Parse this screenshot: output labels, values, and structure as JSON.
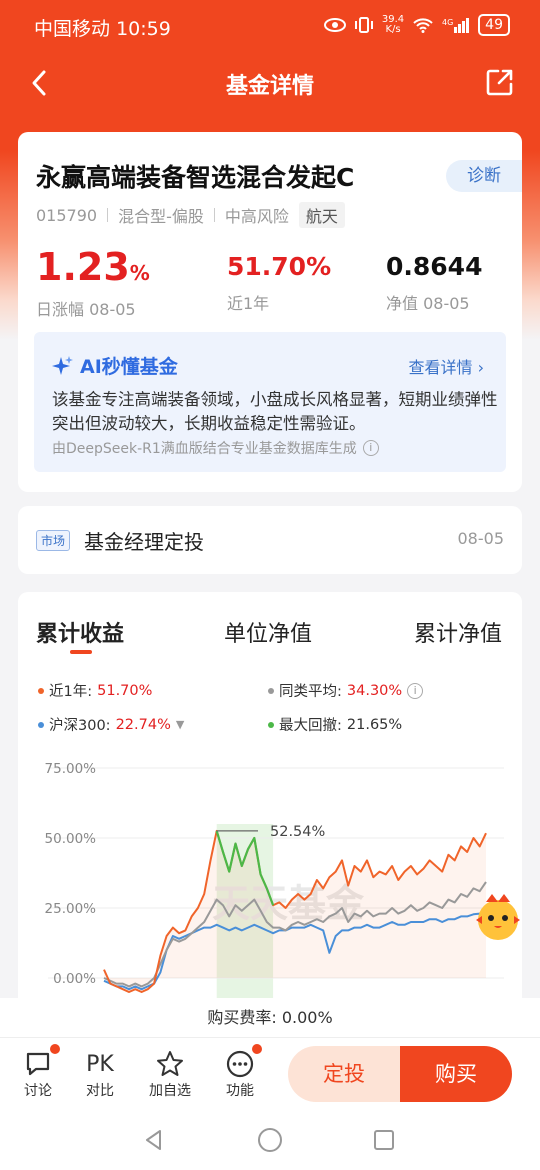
{
  "status_bar": {
    "carrier": "中国移动",
    "time": "10:59",
    "speed_top": "39.4",
    "speed_bottom": "K/s",
    "battery": "49"
  },
  "nav": {
    "title": "基金详情"
  },
  "fund": {
    "name": "永赢高端装备智选混合发起C",
    "diagnose": "诊断",
    "code": "015790",
    "type": "混合型-偏股",
    "risk": "中高风险",
    "sector": "航天",
    "daily_change": "1.23",
    "daily_change_unit": "%",
    "daily_change_label": "日涨幅 08-05",
    "year_return": "51.70%",
    "year_return_label": "近1年",
    "nav_value": "0.8644",
    "nav_label": "净值 08-05"
  },
  "ai": {
    "title": "AI秒懂基金",
    "more": "查看详情",
    "text": "该基金专注高端装备领域，小盘成长风格显著，短期业绩弹性突出但波动较大，长期收益稳定性需验证。",
    "source": "由DeepSeek-R1满血版结合专业基金数据库生成"
  },
  "manager": {
    "tag": "市场",
    "text": "基金经理定投",
    "date": "08-05"
  },
  "chart_tabs": [
    "累计收益",
    "单位净值",
    "累计净值"
  ],
  "legend": {
    "fund_label": "近1年:",
    "fund_value": "51.70%",
    "peer_label": "同类平均:",
    "peer_value": "34.30%",
    "index_label": "沪深300:",
    "index_value": "22.74%",
    "drawdown_label": "最大回撤:",
    "drawdown_value": "21.65%"
  },
  "colors": {
    "fund": "#f0642a",
    "peer": "#999999",
    "index": "#4a8fd8",
    "drawdown": "#4cb848",
    "accent": "#f0461f"
  },
  "chart_data": {
    "type": "line",
    "ylim": [
      -5,
      78
    ],
    "yticks": [
      "75.00%",
      "50.00%",
      "25.00%",
      "0.00%"
    ],
    "ytick_values": [
      75,
      50,
      25,
      0
    ],
    "peak_label": "52.54%",
    "peak_value": 52.54,
    "watermark": "天天基金",
    "series": [
      {
        "name": "近1年",
        "values": [
          3,
          -2,
          -3,
          -4,
          -5,
          -4,
          -5,
          -4,
          -2,
          8,
          15,
          18,
          16,
          17,
          22,
          25,
          30,
          42,
          52.54,
          45,
          38,
          48,
          40,
          46,
          50,
          37,
          32,
          26,
          27,
          25,
          28,
          30,
          28,
          30,
          35,
          32,
          36,
          38,
          42,
          33,
          40,
          38,
          42,
          36,
          38,
          37,
          40,
          35,
          38,
          40,
          37,
          39,
          42,
          40,
          38,
          44,
          42,
          47,
          45,
          50,
          47,
          51.7
        ]
      },
      {
        "name": "同类平均",
        "values": [
          0,
          -1,
          -2,
          -2,
          -3,
          -2,
          -3,
          -2,
          0,
          5,
          10,
          14,
          13,
          14,
          16,
          18,
          20,
          24,
          28,
          26,
          22,
          26,
          24,
          26,
          28,
          24,
          20,
          18,
          18,
          17,
          19,
          20,
          19,
          20,
          21,
          20,
          22,
          23,
          25,
          20,
          23,
          22,
          24,
          22,
          23,
          23,
          25,
          23,
          24,
          26,
          24,
          25,
          27,
          26,
          25,
          28,
          27,
          30,
          29,
          32,
          31,
          34.3
        ]
      },
      {
        "name": "沪深300",
        "values": [
          -1,
          -2,
          -3,
          -3,
          -4,
          -3,
          -4,
          -3,
          -2,
          2,
          10,
          15,
          14,
          15,
          16,
          17,
          18,
          18,
          19,
          18,
          17,
          18,
          17,
          18,
          19,
          18,
          17,
          16,
          17,
          17,
          18,
          18,
          18,
          19,
          18,
          17,
          9,
          15,
          17,
          17,
          18,
          18,
          19,
          18,
          18,
          19,
          20,
          19,
          19,
          20,
          20,
          20,
          21,
          21,
          20,
          21,
          21,
          22,
          22,
          22.74,
          23,
          22.74
        ]
      }
    ],
    "drawdown_range": [
      18,
      27
    ]
  },
  "fee": {
    "label": "购买费率:",
    "value": "0.00%"
  },
  "bottom": {
    "discuss": "讨论",
    "compare_icon": "PK",
    "compare": "对比",
    "watch": "加自选",
    "functions": "功能",
    "dingtou": "定投",
    "buy": "购买"
  }
}
